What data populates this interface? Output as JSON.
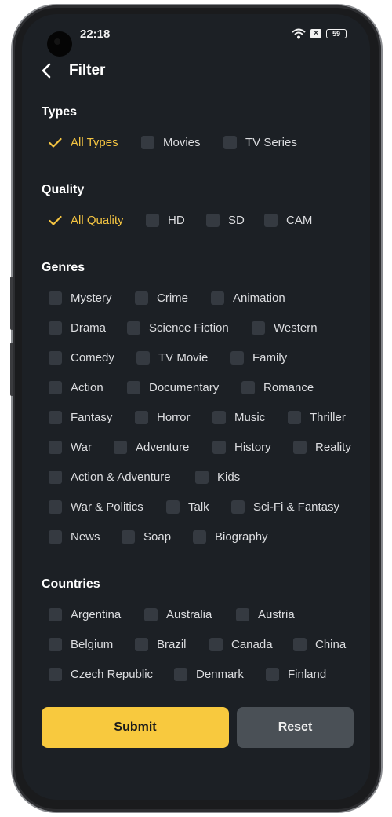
{
  "status": {
    "time": "22:18",
    "battery": "59"
  },
  "header": {
    "title": "Filter"
  },
  "types": {
    "title": "Types",
    "options": [
      "All Types",
      "Movies",
      "TV Series"
    ],
    "selected": "All Types"
  },
  "quality": {
    "title": "Quality",
    "options": [
      "All Quality",
      "HD",
      "SD",
      "CAM"
    ],
    "selected": "All Quality"
  },
  "genres": {
    "title": "Genres",
    "rows": [
      [
        "Mystery",
        "Crime",
        "Animation"
      ],
      [
        "Drama",
        "Science Fiction",
        "Western"
      ],
      [
        "Comedy",
        "TV Movie",
        "Family"
      ],
      [
        "Action",
        "Documentary",
        "Romance"
      ],
      [
        "Fantasy",
        "Horror",
        "Music",
        "Thriller"
      ],
      [
        "War",
        "Adventure",
        "History",
        "Reality"
      ],
      [
        "Action & Adventure",
        "Kids"
      ],
      [
        "War & Politics",
        "Talk",
        "Sci-Fi & Fantasy"
      ],
      [
        "News",
        "Soap",
        "Biography"
      ]
    ]
  },
  "countries": {
    "title": "Countries",
    "rows": [
      [
        "Argentina",
        "Australia",
        "Austria"
      ],
      [
        "Belgium",
        "Brazil",
        "Canada",
        "China"
      ],
      [
        "Czech Republic",
        "Denmark",
        "Finland"
      ]
    ]
  },
  "buttons": {
    "submit": "Submit",
    "reset": "Reset"
  },
  "colors": {
    "accent": "#f8c93e",
    "background": "#1c2025",
    "checkbox": "#353a41"
  }
}
